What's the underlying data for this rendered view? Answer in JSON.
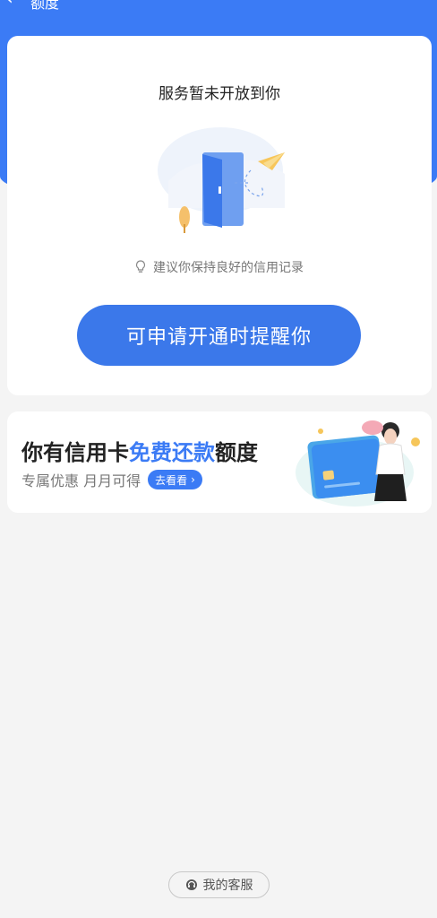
{
  "nav": {
    "back_icon": "back-arrow-icon",
    "title": "额度"
  },
  "main_card": {
    "title": "服务暂未开放到你",
    "tip": "建议你保持良好的信用记录",
    "apply_button": "可申请开通时提醒你"
  },
  "promo": {
    "title_prefix": "你有信用卡",
    "title_highlight": "免费还款",
    "title_suffix": "额度",
    "subtitle": "专属优惠 月月可得",
    "look_button": "去看看"
  },
  "service": {
    "label": "我的客服"
  },
  "colors": {
    "brand": "#3b7bf5",
    "button": "#3b78ea",
    "page_bg": "#f4f4f4"
  }
}
